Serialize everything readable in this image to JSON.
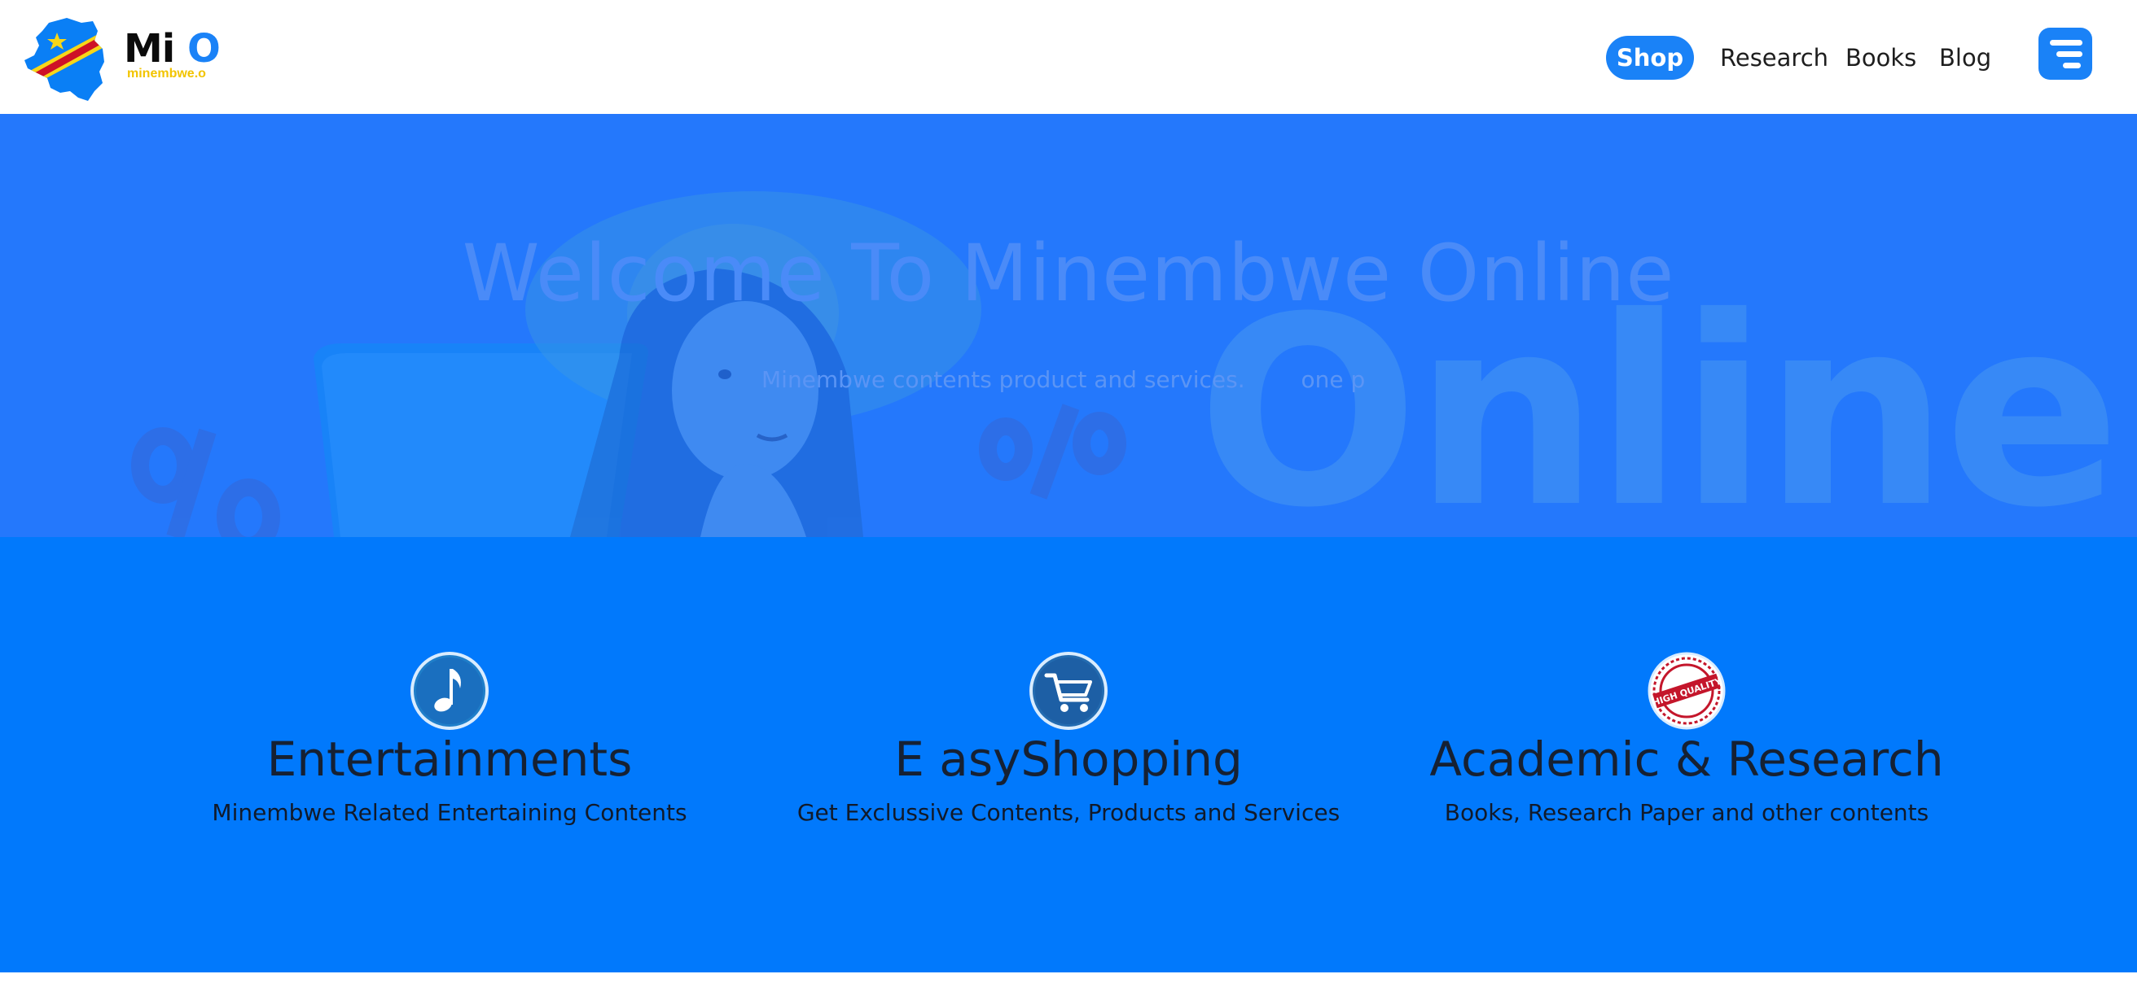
{
  "brand": {
    "title_main": "Mi",
    "title_accent": "O",
    "tagline": "minembwe.o"
  },
  "nav": {
    "items": [
      {
        "label": "Shop",
        "active": true
      },
      {
        "label": "Research",
        "active": false
      },
      {
        "label": "Books",
        "active": false
      },
      {
        "label": "Blog",
        "active": false
      }
    ],
    "menu_icon": "hamburger-menu-icon"
  },
  "hero": {
    "title": "Welcome To Minembwe Online",
    "subtitle_visible": "Minembwe contents product and services.",
    "subtitle_fragment": "one p",
    "background_word": "Online",
    "background_symbol": "%"
  },
  "features": [
    {
      "icon": "music-note-icon",
      "title": "Entertainments",
      "description": "Minembwe Related Entertaining Contents"
    },
    {
      "icon": "shopping-cart-icon",
      "title": "E asyShopping",
      "description": "Get Exclussive Contents, Products and Services"
    },
    {
      "icon": "high-quality-badge-icon",
      "title": "Academic & Research",
      "description": "Books, Research Paper and other contents",
      "badge_text": "HIGH QUALITY"
    }
  ],
  "colors": {
    "primary": "#1a82f7",
    "hero_bg": "#2478fc",
    "features_bg": "#0179fc",
    "brand_yellow": "#f2c400",
    "flag_red": "#d21034"
  }
}
